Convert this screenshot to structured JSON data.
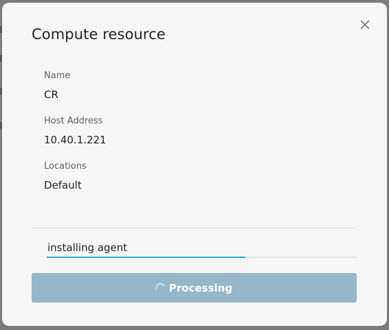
{
  "dialog": {
    "title": "Compute resource"
  },
  "fields": {
    "name": {
      "label": "Name",
      "value": "CR"
    },
    "host": {
      "label": "Host Address",
      "value": "10.40.1.221"
    },
    "locations": {
      "label": "Locations",
      "value": "Default"
    }
  },
  "progress": {
    "text": "installing agent",
    "fraction": 0.64,
    "fill_color": "#2aa8de"
  },
  "button": {
    "label": "Processing",
    "icon": "spinner-icon",
    "color": "#95b7c9"
  },
  "icons": {
    "close": "close-icon"
  }
}
